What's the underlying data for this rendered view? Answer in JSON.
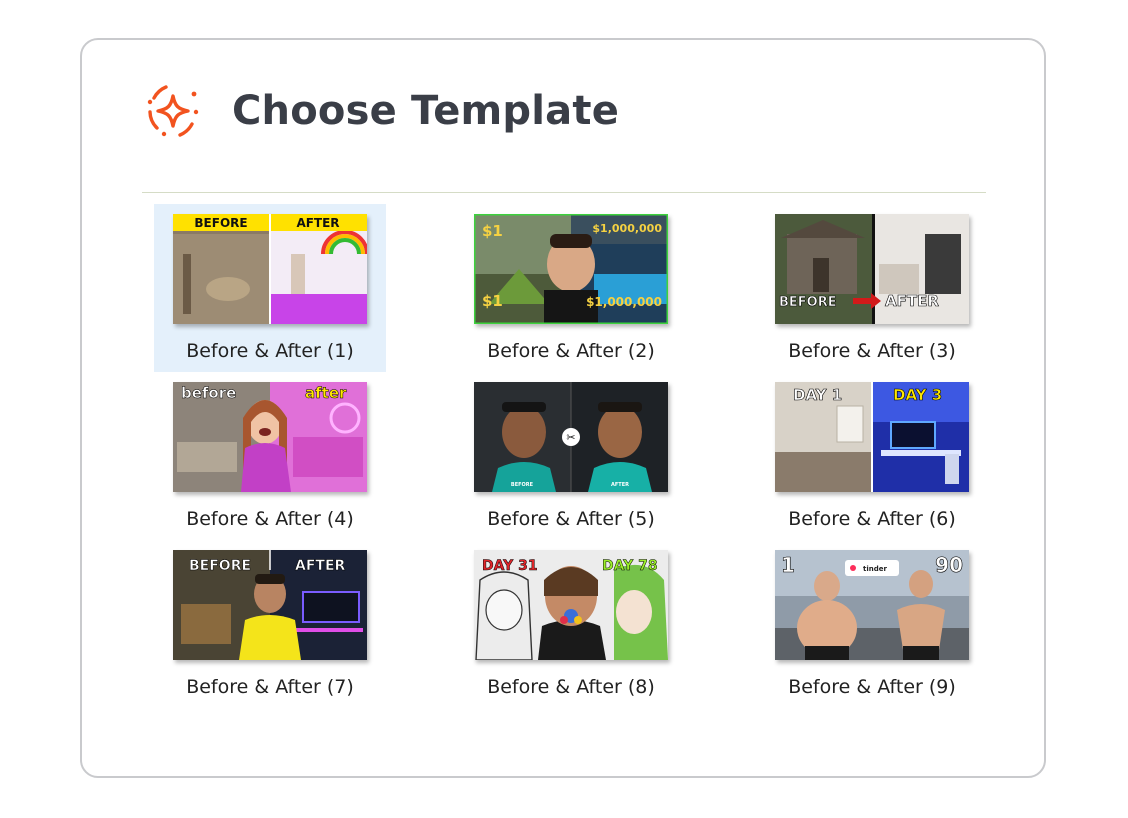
{
  "dialog": {
    "title": "Choose Template",
    "icon": "sparkle-icon",
    "accent_color": "#f2531f"
  },
  "templates": [
    {
      "label": "Before & After (1)",
      "selected": true,
      "overlay_left": "BEFORE",
      "overlay_right": "AFTER"
    },
    {
      "label": "Before & After (2)",
      "selected": false,
      "overlay_left": "$1",
      "overlay_right": "$1,000,000"
    },
    {
      "label": "Before & After (3)",
      "selected": false,
      "overlay_left": "BEFORE",
      "overlay_right": "AFTER"
    },
    {
      "label": "Before & After (4)",
      "selected": false,
      "overlay_left": "before",
      "overlay_right": "after"
    },
    {
      "label": "Before & After (5)",
      "selected": false,
      "overlay_left": "BEFORE",
      "overlay_right": "AFTER"
    },
    {
      "label": "Before & After (6)",
      "selected": false,
      "overlay_left": "DAY 1",
      "overlay_right": "DAY 3"
    },
    {
      "label": "Before & After (7)",
      "selected": false,
      "overlay_left": "BEFORE",
      "overlay_right": "AFTER"
    },
    {
      "label": "Before & After (8)",
      "selected": false,
      "overlay_left": "DAY 31",
      "overlay_right": "DAY 78"
    },
    {
      "label": "Before & After (9)",
      "selected": false,
      "overlay_left": "1",
      "overlay_right": "90"
    }
  ]
}
